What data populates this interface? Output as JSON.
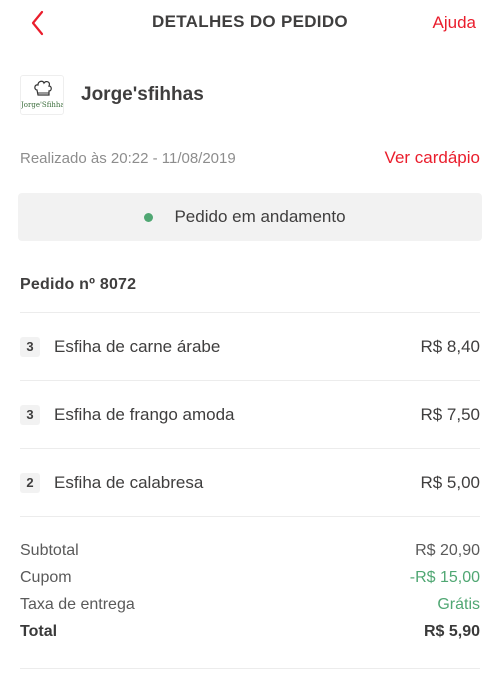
{
  "header": {
    "title": "DETALHES DO PEDIDO",
    "help_label": "Ajuda",
    "back_icon": "chevron-left-icon"
  },
  "store": {
    "logo_text": "Jorge'Sfihhas",
    "name": "Jorge'sfihhas"
  },
  "meta": {
    "placed_at": "Realizado às 20:22 - 11/08/2019",
    "menu_label": "Ver cardápio"
  },
  "status": {
    "text": "Pedido em andamento",
    "color": "#50a773"
  },
  "order": {
    "number_label": "Pedido nº 8072"
  },
  "items": [
    {
      "qty": "3",
      "name": "Esfiha de carne árabe",
      "price": "R$ 8,40"
    },
    {
      "qty": "3",
      "name": "Esfiha de frango amoda",
      "price": "R$ 7,50"
    },
    {
      "qty": "2",
      "name": "Esfiha de calabresa",
      "price": "R$ 5,00"
    }
  ],
  "summary": {
    "subtotal_label": "Subtotal",
    "subtotal_value": "R$ 20,90",
    "coupon_label": "Cupom",
    "coupon_value": "-R$ 15,00",
    "delivery_label": "Taxa de entrega",
    "delivery_value": "Grátis",
    "total_label": "Total",
    "total_value": "R$ 5,90"
  },
  "colors": {
    "accent": "#ea1d2c",
    "positive": "#50a773"
  }
}
